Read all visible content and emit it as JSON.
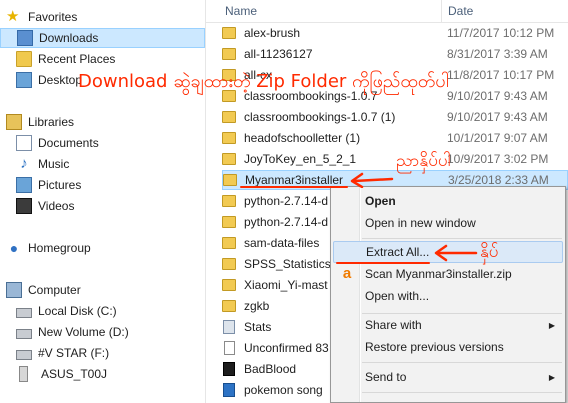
{
  "nav": {
    "favorites": "Favorites",
    "downloads": "Downloads",
    "recent_places": "Recent Places",
    "desktop": "Desktop",
    "libraries": "Libraries",
    "documents": "Documents",
    "music": "Music",
    "pictures": "Pictures",
    "videos": "Videos",
    "homegroup": "Homegroup",
    "computer": "Computer",
    "local_disk": "Local Disk (C:)",
    "new_volume": "New Volume (D:)",
    "v_star": "#V STAR (F:)",
    "asus": "ASUS_T00J"
  },
  "columns": {
    "name": "Name",
    "date": "Date"
  },
  "files": [
    {
      "name": "alex-brush",
      "date": "11/7/2017 10:12 PM"
    },
    {
      "name": "all-11236127",
      "date": "8/31/2017 3:39 AM"
    },
    {
      "name": "all-cx",
      "date": "11/8/2017 10:17 PM"
    },
    {
      "name": "classroombookings-1.0.7",
      "date": "9/10/2017 9:43 AM"
    },
    {
      "name": "classroombookings-1.0.7 (1)",
      "date": "9/10/2017 9:43 AM"
    },
    {
      "name": "headofschoolletter (1)",
      "date": "10/1/2017 9:07 AM"
    },
    {
      "name": "JoyToKey_en_5_2_1",
      "date": "10/9/2017 3:02 PM"
    },
    {
      "name": "Myanmar3installer",
      "date": "3/25/2018 2:33 AM"
    },
    {
      "name": "python-2.7.14-d",
      "date": ""
    },
    {
      "name": "python-2.7.14-d",
      "date": ""
    },
    {
      "name": "sam-data-files",
      "date": ""
    },
    {
      "name": "SPSS_Statistics_2",
      "date": ""
    },
    {
      "name": "Xiaomi_Yi-mast",
      "date": ""
    },
    {
      "name": "zgkb",
      "date": ""
    },
    {
      "name": "Stats",
      "date": ""
    },
    {
      "name": "Unconfirmed 83",
      "date": ""
    },
    {
      "name": "BadBlood",
      "date": ""
    },
    {
      "name": "pokemon song",
      "date": ""
    }
  ],
  "menu": {
    "open": "Open",
    "open_new_window": "Open in new window",
    "extract_all": "Extract All...",
    "scan": "Scan Myanmar3installer.zip",
    "open_with": "Open with...",
    "share_with": "Share with",
    "restore": "Restore previous versions",
    "send_to": "Send to"
  },
  "annotations": {
    "headline": "Download ဆွဲချထားတဲ့ Zip Folder ကိုဖြည်ထုတ်ပါ",
    "select_label": "ညာနှိပ်ပါ",
    "click_label": "နှိပ်"
  },
  "colors": {
    "annotation": "#ff2a00",
    "selection": "#cce8ff",
    "selection_border": "#99d1ff"
  }
}
